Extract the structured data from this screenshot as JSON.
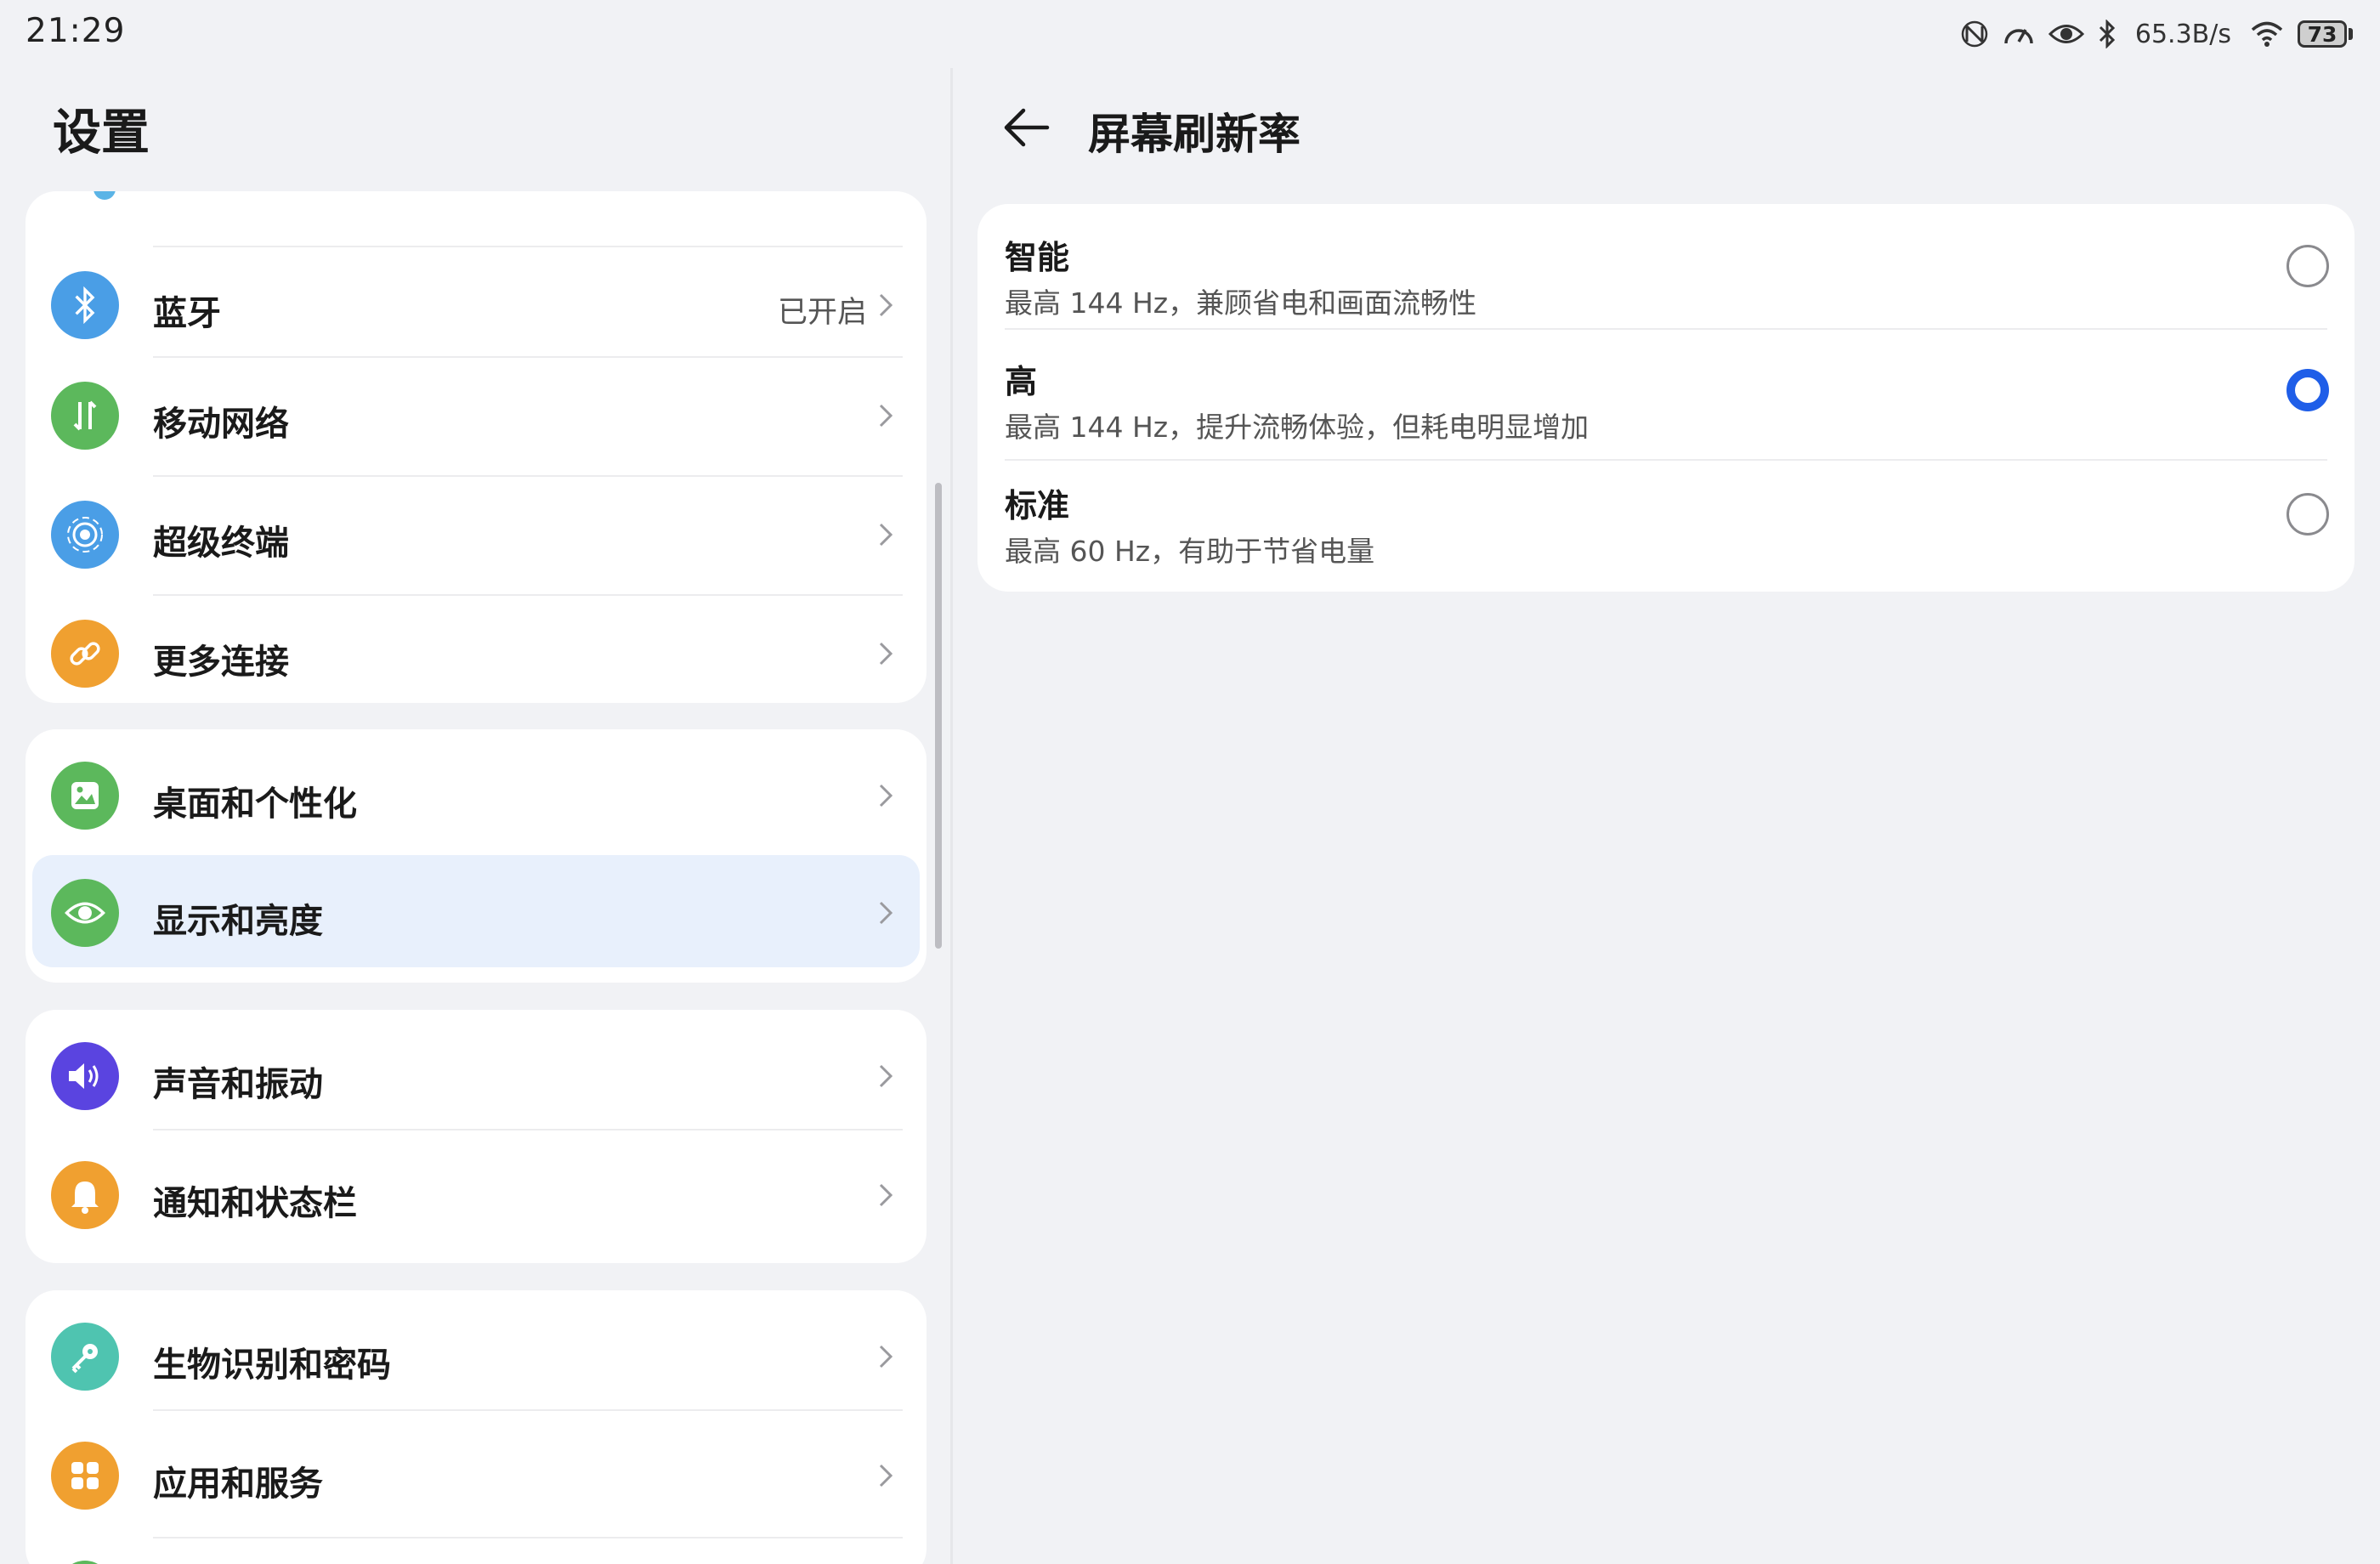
{
  "status_bar": {
    "time": "21:29",
    "net_speed": "65.3B/s",
    "battery": "73",
    "icons": [
      "nfc-icon",
      "speed-dial-icon",
      "eye-comfort-icon",
      "bluetooth-icon",
      "wifi-icon",
      "battery-icon"
    ]
  },
  "left": {
    "title": "设置",
    "groups": [
      {
        "items": [
          {
            "label": "蓝牙",
            "value": "已开启",
            "icon": "bluetooth-icon",
            "color": "#4a9ee6"
          },
          {
            "label": "移动网络",
            "value": "",
            "icon": "mobile-data-icon",
            "color": "#5cb85c"
          },
          {
            "label": "超级终端",
            "value": "",
            "icon": "super-device-icon",
            "color": "#4a9ee6"
          },
          {
            "label": "更多连接",
            "value": "",
            "icon": "link-icon",
            "color": "#f0a030"
          }
        ]
      },
      {
        "items": [
          {
            "label": "桌面和个性化",
            "value": "",
            "icon": "wallpaper-icon",
            "color": "#5cb85c"
          },
          {
            "label": "显示和亮度",
            "value": "",
            "icon": "eye-icon",
            "color": "#5cb85c",
            "selected": true
          }
        ]
      },
      {
        "items": [
          {
            "label": "声音和振动",
            "value": "",
            "icon": "speaker-icon",
            "color": "#5a44e0"
          },
          {
            "label": "通知和状态栏",
            "value": "",
            "icon": "bell-icon",
            "color": "#f0a030"
          }
        ]
      },
      {
        "items": [
          {
            "label": "生物识别和密码",
            "value": "",
            "icon": "key-icon",
            "color": "#4fc4b0"
          },
          {
            "label": "应用和服务",
            "value": "",
            "icon": "apps-icon",
            "color": "#f0a030"
          }
        ]
      }
    ]
  },
  "right": {
    "title": "屏幕刷新率",
    "options": [
      {
        "title": "智能",
        "subtitle": "最高 144 Hz，兼顾省电和画面流畅性",
        "selected": false
      },
      {
        "title": "高",
        "subtitle": "最高 144 Hz，提升流畅体验，但耗电明显增加",
        "selected": true
      },
      {
        "title": "标准",
        "subtitle": "最高 60 Hz，有助于节省电量",
        "selected": false
      }
    ]
  },
  "colors": {
    "accent": "#1f5ee8",
    "background": "#f1f2f5",
    "selected_row": "#e8f0fc"
  }
}
